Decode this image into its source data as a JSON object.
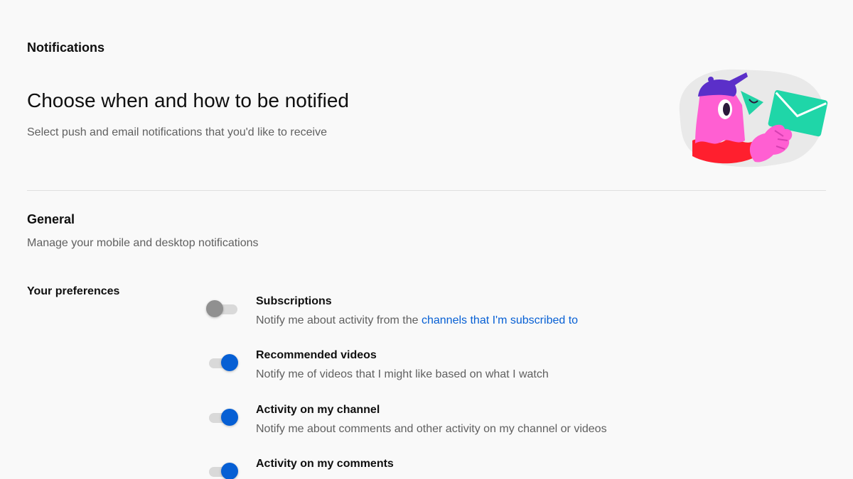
{
  "header": {
    "section_label": "Notifications",
    "headline": "Choose when and how to be notified",
    "subline": "Select push and email notifications that you'd like to receive"
  },
  "illustration": {
    "icon": "envelope-bird-illustration",
    "colors": {
      "blob": "#e9e9e9",
      "body": "#ff5fd2",
      "hat": "#5b2fc9",
      "scarf": "#ff1f2e",
      "envelope": "#1fd6a8",
      "beak": "#22d3a6"
    }
  },
  "general": {
    "title": "General",
    "subtitle": "Manage your mobile and desktop notifications"
  },
  "preferences": {
    "label": "Your preferences",
    "items": [
      {
        "title": "Subscriptions",
        "desc_prefix": "Notify me about activity from the ",
        "desc_link": "channels that I'm subscribed to",
        "enabled": false
      },
      {
        "title": "Recommended videos",
        "desc_prefix": "Notify me of videos that I might like based on what I watch",
        "desc_link": "",
        "enabled": true
      },
      {
        "title": "Activity on my channel",
        "desc_prefix": "Notify me about comments and other activity on my channel or videos",
        "desc_link": "",
        "enabled": true
      },
      {
        "title": "Activity on my comments",
        "desc_prefix": "",
        "desc_link": "",
        "enabled": true
      }
    ]
  },
  "colors": {
    "accent": "#065fd4",
    "toggle_off_knob": "#909090",
    "toggle_track": "#d9d9d9",
    "background": "#f9f9f9",
    "secondary_text": "#606060"
  }
}
